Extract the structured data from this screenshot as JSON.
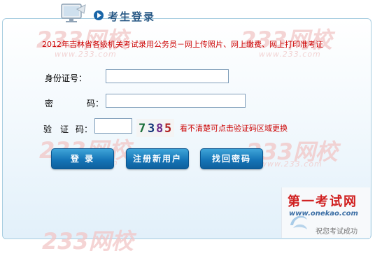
{
  "header": {
    "title": "考生登录"
  },
  "watermarks": {
    "text": "233网校",
    "url": "www.233.com"
  },
  "notice": "2012年吉林省各级机关考试录用公务员－网上传照片、网上缴费、网上打印准考证",
  "form": {
    "id_label": "身份证号：",
    "password_label_1": "密",
    "password_label_2": "码：",
    "captcha_label_1": "验",
    "captcha_label_2": "证",
    "captcha_label_3": "码：",
    "id_value": "",
    "password_value": "",
    "captcha_value": "",
    "captcha_code": [
      "7",
      "3",
      "8",
      "5"
    ],
    "captcha_colors": [
      "#1c6f3a",
      "#14387a",
      "#6d2a8a",
      "#b02020"
    ],
    "captcha_hint": "看不清楚可点击验证码区域更换"
  },
  "buttons": {
    "login": "登 录",
    "register": "注册新用户",
    "recover": "找回密码"
  },
  "brand": {
    "name": "第一考试网",
    "url": "www.onekao.com",
    "slogan": "祝您考试成功"
  }
}
